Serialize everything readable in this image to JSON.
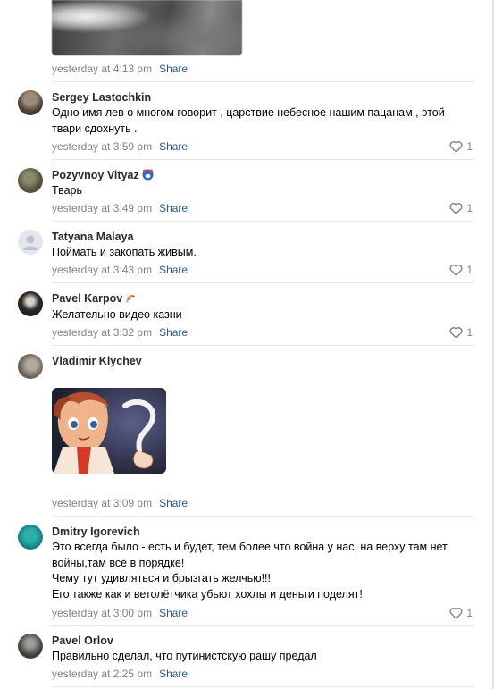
{
  "share_label": "Share",
  "first_post": {
    "time": "yesterday at 4:13 pm"
  },
  "comments": [
    {
      "author": "Sergey Lastochkin",
      "text": "Одно имя лев о многом говорит , царствие небесное нашим пацанам , этой твари сдохнуть .",
      "time": "yesterday at 3:59 pm",
      "likes": "1"
    },
    {
      "author": "Pozyvnoy Vityaz",
      "text": "Тварь",
      "time": "yesterday at 3:49 pm",
      "likes": "1"
    },
    {
      "author": "Tatyana Malaya",
      "text": "Поймать и закопать живым.",
      "time": "yesterday at 3:43 pm",
      "likes": "1"
    },
    {
      "author": "Pavel Karpov",
      "text": "Желательно видео казни",
      "time": "yesterday at 3:32 pm",
      "likes": "1"
    },
    {
      "author": "Vladimir Klychev",
      "text": "",
      "time": "yesterday at 3:09 pm",
      "likes": ""
    },
    {
      "author": "Dmitry Igorevich",
      "text": "Это всегда было - есть и будет, тем более что война у нас, на верху там нет войны,там всё в порядке!\nЧему тут удивляться и брызгать желчью!!!\nЕго также как и ветолётчика убьют хохлы и деньги поделят!",
      "time": "yesterday at 3:00 pm",
      "likes": "1"
    },
    {
      "author": "Pavel Orlov",
      "text": "Правильно сделал, что путинистскую рашу предал",
      "time": "yesterday at 2:25 pm",
      "likes": ""
    }
  ],
  "colors": {
    "link": "#2a5885",
    "meta": "#828282",
    "divider": "#e7e8ec"
  }
}
